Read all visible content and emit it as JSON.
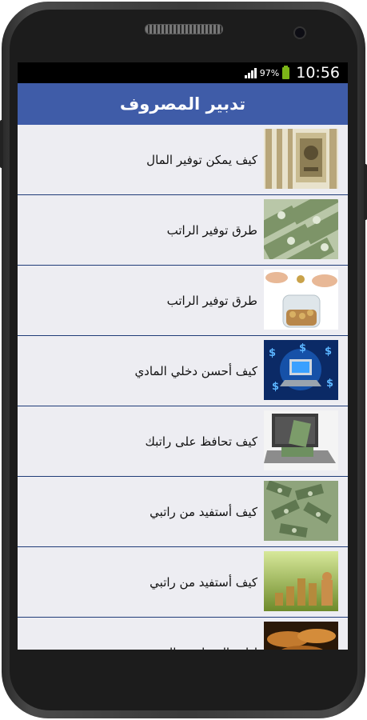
{
  "status_bar": {
    "battery_percent": "97%",
    "time": "10:56"
  },
  "app_bar": {
    "title": "تدبير المصروف"
  },
  "items": [
    {
      "label": "كيف يمكن توفير المال",
      "thumb": "dollar-bills-stack"
    },
    {
      "label": "طرق توفير الراتب",
      "thumb": "dollar-bills-pile"
    },
    {
      "label": "طرق توفير الراتب",
      "thumb": "coin-jar"
    },
    {
      "label": "كيف أحسن دخلي المادي",
      "thumb": "laptop-dollars"
    },
    {
      "label": "كيف تحافظ على راتبك",
      "thumb": "laptop-cash"
    },
    {
      "label": "كيف أستفيد من راتبي",
      "thumb": "money-pile"
    },
    {
      "label": "كيف أستفيد من راتبي",
      "thumb": "coin-stacks"
    },
    {
      "label": "إدارة المصاريف الشهرية",
      "thumb": "coins-closeup"
    }
  ]
}
